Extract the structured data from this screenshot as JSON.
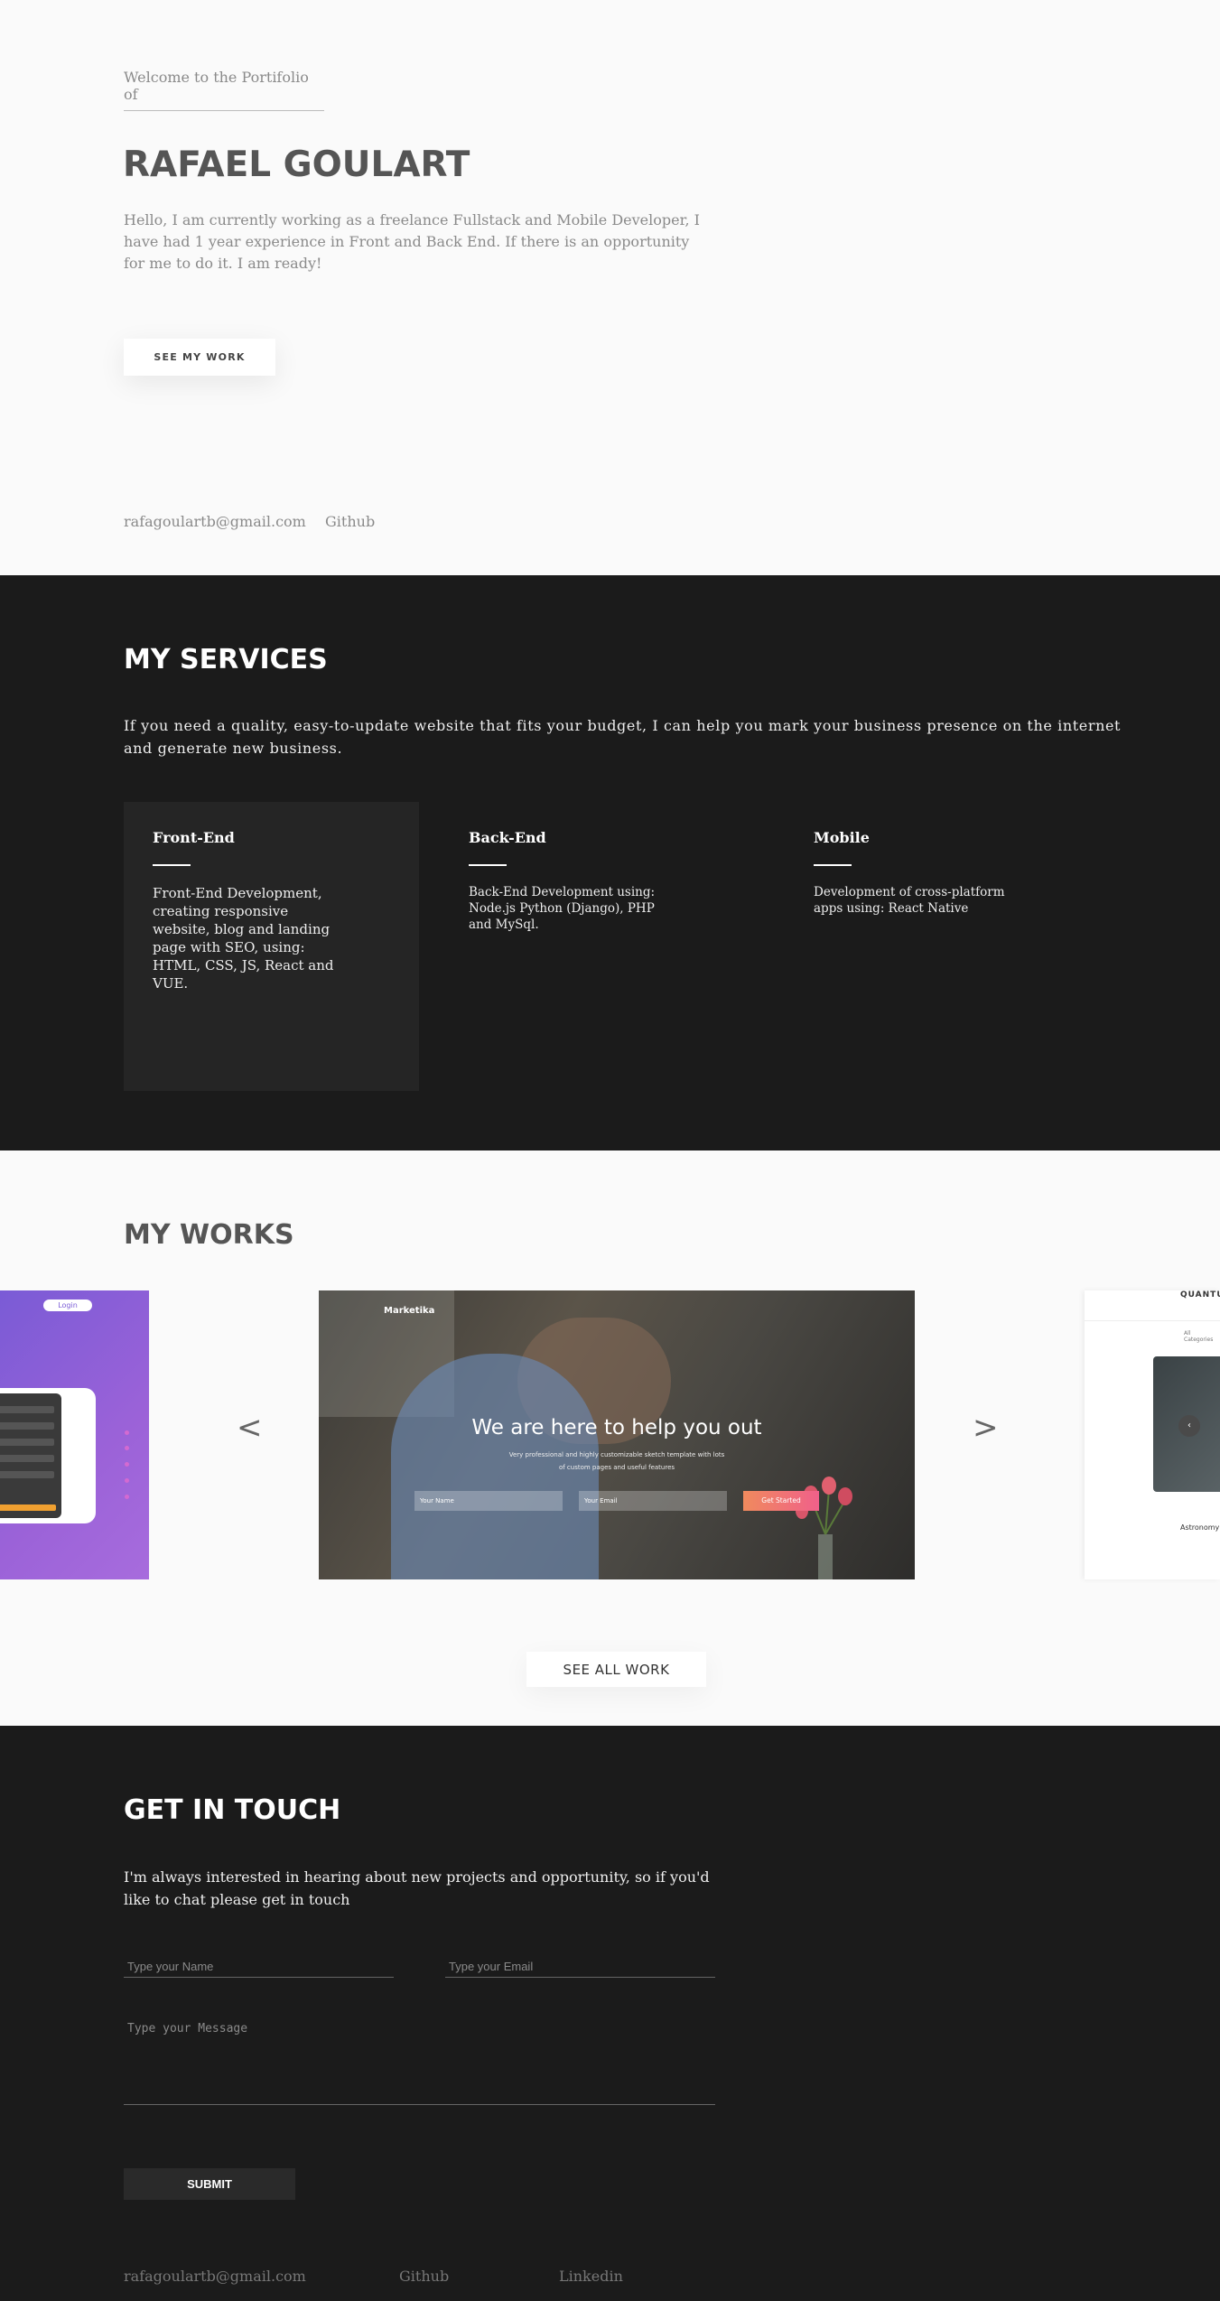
{
  "hero": {
    "welcome": "Welcome to the Portifolio of",
    "name": "RAFAEL GOULART",
    "intro": "Hello, I am currently working as a freelance Fullstack and Mobile Developer, I have had 1 year experience in Front and Back End. If there is an opportunity for me to do it. I am ready!",
    "cta": "SEE MY WORK",
    "email": "rafagoulartb@gmail.com",
    "github": "Github"
  },
  "services": {
    "title": "MY SERVICES",
    "lead": "If you need a quality, easy-to-update website that fits your budget, I can help you mark your business presence on the internet and generate new business.",
    "items": [
      {
        "title": "Front-End",
        "text": "Front-End Development, creating responsive website, blog and landing page with SEO, using: HTML, CSS, JS, React and VUE."
      },
      {
        "title": "Back-End",
        "text": "Back-End Development using: Node.js Python (Django), PHP and MySql."
      },
      {
        "title": "Mobile",
        "text": "Development of cross-platform apps using: React Native"
      }
    ]
  },
  "works": {
    "title": "MY WORKS",
    "prev": "<",
    "next": ">",
    "cta": "SEE ALL WORK",
    "slide_left": {
      "button": "Login"
    },
    "slide_main": {
      "brand": "Marketika",
      "headline": "We are here to help you out",
      "sub1": "Very professional and highly customizable sketch template with lots",
      "sub2": "of custom pages and useful features",
      "name_placeholder": "Your Name",
      "email_placeholder": "Your Email",
      "button": "Get Started"
    },
    "slide_right": {
      "title": "QUANTU",
      "category": "All Categories",
      "caption": "Astronomy"
    }
  },
  "contact": {
    "title": "GET IN TOUCH",
    "lead": "I'm always interested in hearing about new projects and opportunity, so if you'd like to chat please get in touch",
    "name_placeholder": "Type your Name",
    "email_placeholder": "Type your Email",
    "message_placeholder": "Type your Message",
    "submit": "SUBMIT",
    "email": "rafagoulartb@gmail.com",
    "github": "Github",
    "linkedin": "Linkedin"
  }
}
